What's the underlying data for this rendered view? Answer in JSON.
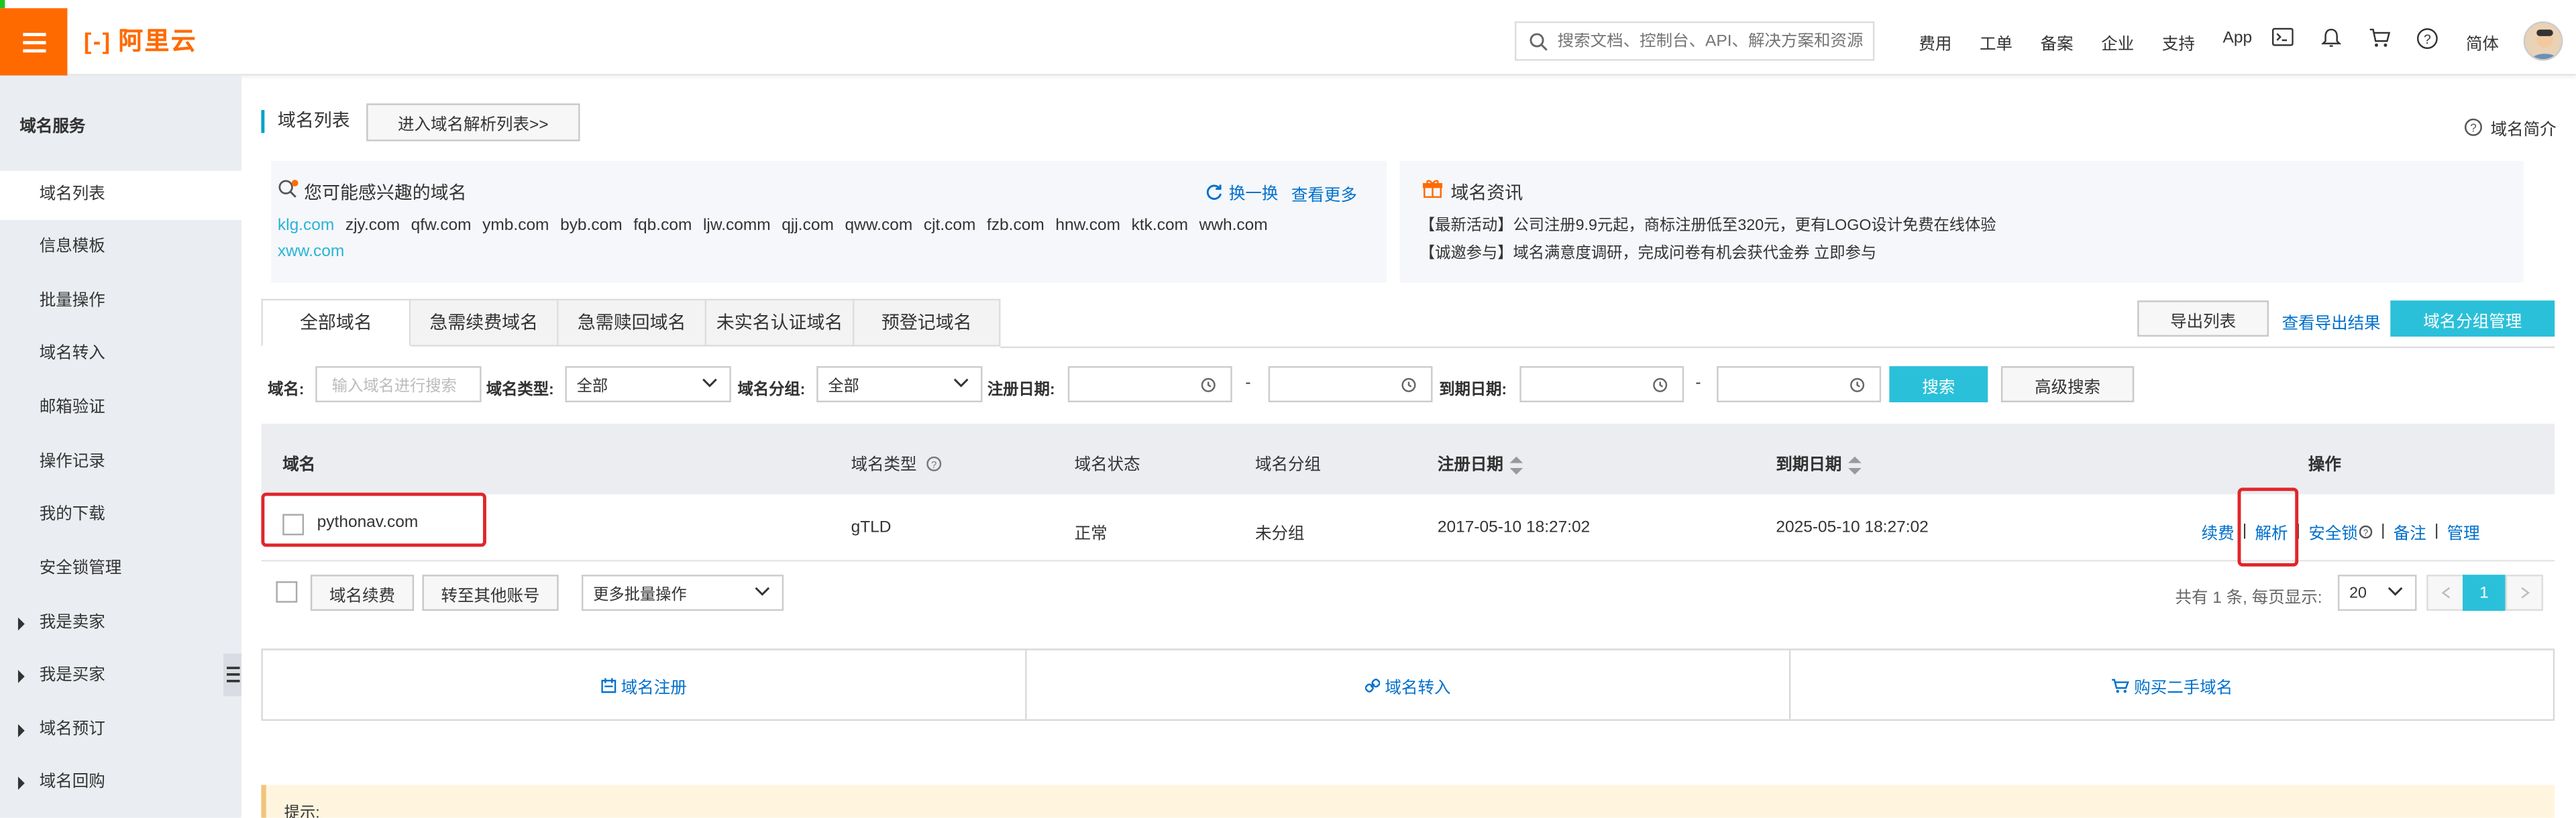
{
  "topbar": {
    "logo_mark": "[-]",
    "logo_text": "阿里云",
    "search_placeholder": "搜索文档、控制台、API、解决方案和资源",
    "nav": [
      "费用",
      "工单",
      "备案",
      "企业",
      "支持",
      "App"
    ],
    "lang": "简体",
    "accent": "#ff6a00"
  },
  "sidebar": {
    "title": "域名服务",
    "items": [
      {
        "label": "域名列表",
        "active": true
      },
      {
        "label": "信息模板"
      },
      {
        "label": "批量操作"
      },
      {
        "label": "域名转入"
      },
      {
        "label": "邮箱验证"
      },
      {
        "label": "操作记录"
      },
      {
        "label": "我的下载"
      },
      {
        "label": "安全锁管理"
      }
    ],
    "groups": [
      "我是卖家",
      "我是买家",
      "域名预订",
      "域名回购"
    ]
  },
  "main": {
    "title": "域名列表",
    "enter_dns_button": "进入域名解析列表>>",
    "intro_link": "域名简介",
    "interest": {
      "title": "您可能感兴趣的域名",
      "swap": "换一换",
      "more": "查看更多",
      "domains": [
        "klg.com",
        "zjy.com",
        "qfw.com",
        "ymb.com",
        "byb.com",
        "fqb.com",
        "ljw.comm",
        "qjj.com",
        "qww.com",
        "cjt.com",
        "fzb.com",
        "hnw.com",
        "ktk.com",
        "wwh.com",
        "xww.com"
      ]
    },
    "news": {
      "title": "域名资讯",
      "lines": [
        "【最新活动】公司注册9.9元起，商标注册低至320元，更有LOGO设计免费在线体验",
        "【诚邀参与】域名满意度调研，完成问卷有机会获代金券 立即参与"
      ]
    },
    "tabs": [
      "全部域名",
      "急需续费域名",
      "急需赎回域名",
      "未实名认证域名",
      "预登记域名"
    ],
    "export_list": "导出列表",
    "view_export": "查看导出结果",
    "group_manage": "域名分组管理",
    "filters": {
      "domain_label": "域名:",
      "domain_placeholder": "输入域名进行搜索",
      "type_label": "域名类型:",
      "type_value": "全部",
      "group_label": "域名分组:",
      "group_value": "全部",
      "reg_label": "注册日期:",
      "exp_label": "到期日期:",
      "dash": "-",
      "search": "搜索",
      "advanced": "高级搜索"
    },
    "table": {
      "headers": [
        "域名",
        "域名类型",
        "域名状态",
        "域名分组",
        "注册日期",
        "到期日期",
        "操作"
      ],
      "rows": [
        {
          "domain": "pythonav.com",
          "type": "gTLD",
          "status": "正常",
          "group": "未分组",
          "reg": "2017-05-10 18:27:02",
          "exp": "2025-05-10 18:27:02",
          "actions": [
            "续费",
            "解析",
            "安全锁",
            "备注",
            "管理"
          ]
        }
      ]
    },
    "footer": {
      "renew": "域名续费",
      "transfer": "转至其他账号",
      "batch": "更多批量操作",
      "total": "共有 1 条, 每页显示:",
      "page_size": "20",
      "page": "1"
    },
    "bottom": [
      "域名注册",
      "域名转入",
      "购买二手域名"
    ],
    "tip": "提示:"
  }
}
